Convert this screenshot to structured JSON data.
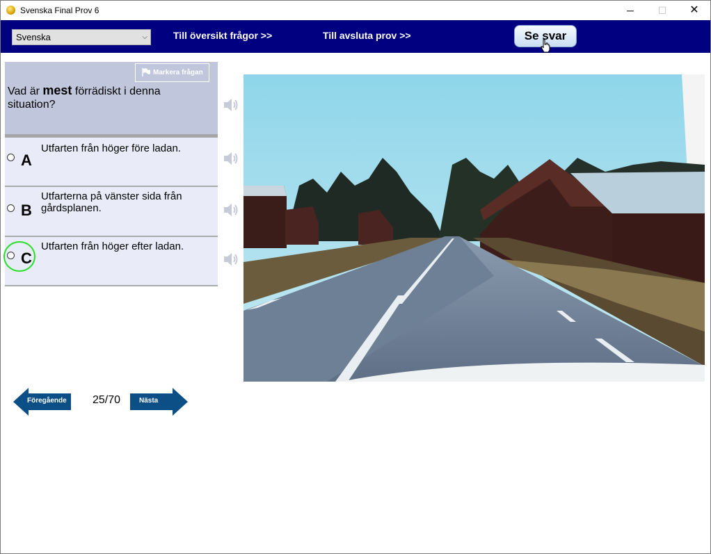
{
  "window": {
    "title": "Svenska Final Prov 6",
    "minimize_icon": "─",
    "maximize_icon": "☐",
    "close_icon": "✕"
  },
  "toolbar": {
    "language": "Svenska",
    "overview_link": "Till översikt frågor >>",
    "finish_link": "Till avsluta prov  >>",
    "answer_button": "Se svar"
  },
  "question": {
    "mark_button": "Markera frågan",
    "prefix": "Vad är ",
    "emphasis": "mest",
    "suffix": "  förrädiskt i denna situation?"
  },
  "options": [
    {
      "letter": "A",
      "text": "Utfarten från höger före ladan."
    },
    {
      "letter": "B",
      "text": "Utfarterna på vänster sida från gårdsplanen."
    },
    {
      "letter": "C",
      "text": "Utfarten från höger efter ladan."
    }
  ],
  "navigation": {
    "previous": "Föregående",
    "next": "Nästa",
    "counter": "25/70"
  },
  "colors": {
    "navbar": "#000080",
    "question_panel": "#c0c6db",
    "option_bg": "#e9ecf8",
    "arrow": "#0b4f86",
    "focus": "#28e028"
  },
  "icons": [
    "app-icon",
    "flag-icon",
    "speaker-icon",
    "cursor-icon",
    "chevron-down-icon"
  ]
}
